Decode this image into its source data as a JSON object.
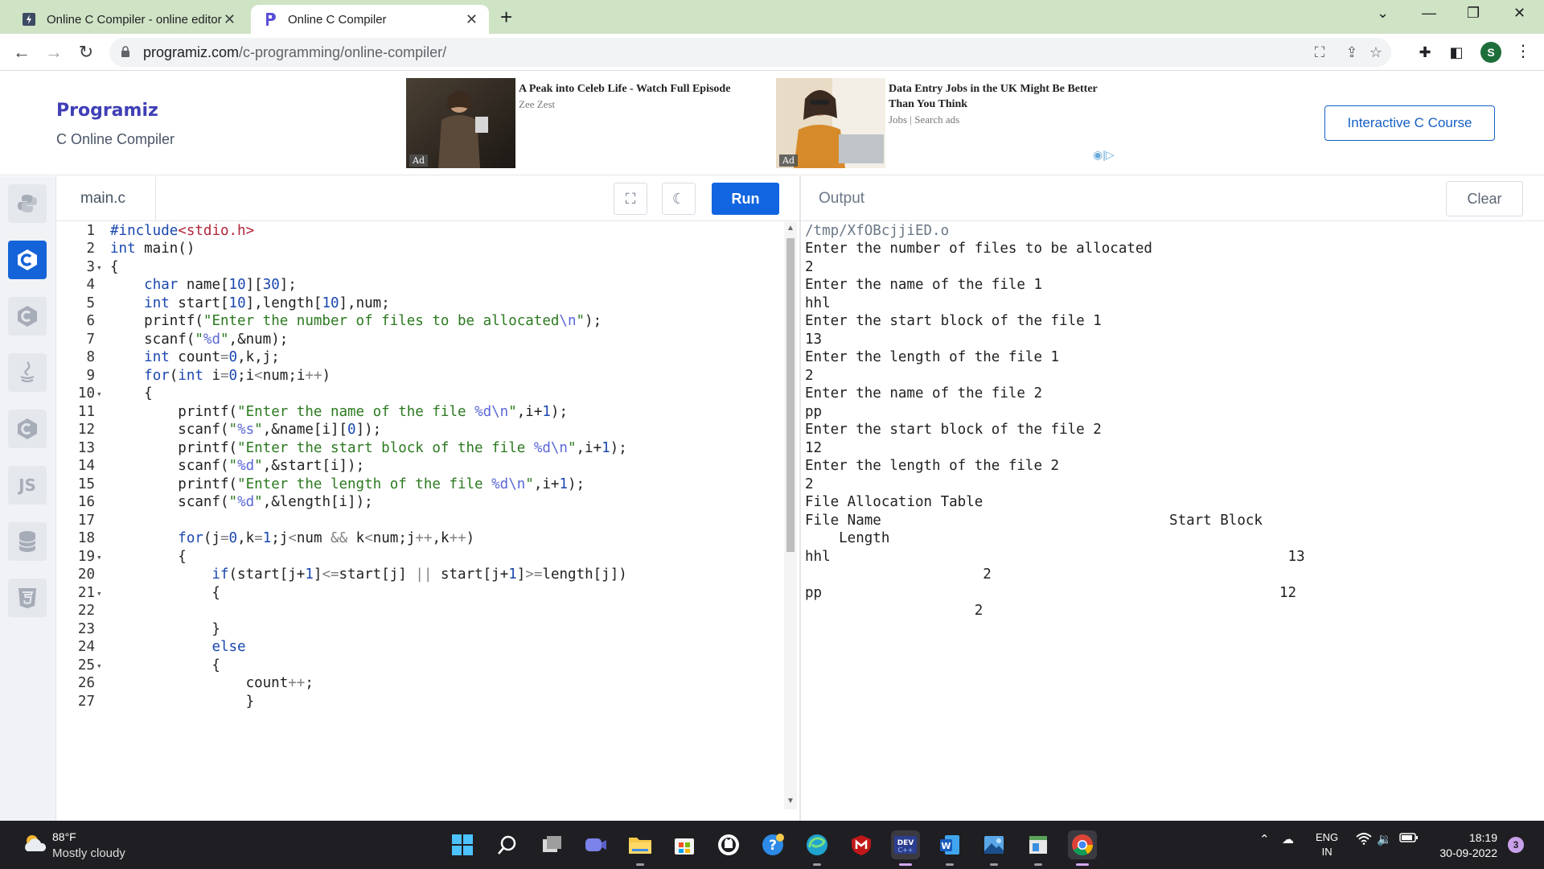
{
  "browser": {
    "tabs": [
      {
        "title": "Online C Compiler - online editor",
        "active": false
      },
      {
        "title": "Online C Compiler",
        "active": true
      }
    ],
    "new_tab": "+",
    "url_host": "programiz.com",
    "url_path": "/c-programming/online-compiler/",
    "profile_initial": "S"
  },
  "site": {
    "logo": "Programiz",
    "subtitle": "C Online Compiler",
    "course_button": "Interactive C Course",
    "ads": [
      {
        "title": "A Peak into Celeb Life - Watch Full Episode",
        "source": "Zee Zest",
        "badge": "Ad"
      },
      {
        "title": "Data Entry Jobs in the UK Might Be Better Than You Think",
        "source": "Jobs | Search ads",
        "badge": "Ad"
      }
    ]
  },
  "sidebar": {
    "languages": [
      {
        "name": "python-icon",
        "active": false
      },
      {
        "name": "c-icon",
        "active": true
      },
      {
        "name": "cpp-icon",
        "active": false
      },
      {
        "name": "java-icon",
        "active": false
      },
      {
        "name": "csharp-icon",
        "active": false
      },
      {
        "name": "js-icon",
        "active": false,
        "label": "JS"
      },
      {
        "name": "sql-icon",
        "active": false
      },
      {
        "name": "html-icon",
        "active": false
      }
    ]
  },
  "editor": {
    "filename": "main.c",
    "run_label": "Run",
    "lines": [
      {
        "n": "1",
        "fold": false,
        "code": "#include<stdio.h>"
      },
      {
        "n": "2",
        "fold": false,
        "code": "int main()"
      },
      {
        "n": "3",
        "fold": true,
        "code": "{"
      },
      {
        "n": "4",
        "fold": false,
        "code": "    char name[10][30];"
      },
      {
        "n": "5",
        "fold": false,
        "code": "    int start[10],length[10],num;"
      },
      {
        "n": "6",
        "fold": false,
        "code": "    printf(\"Enter the number of files to be allocated\\n\");"
      },
      {
        "n": "7",
        "fold": false,
        "code": "    scanf(\"%d\",&num);"
      },
      {
        "n": "8",
        "fold": false,
        "code": "    int count=0,k,j;"
      },
      {
        "n": "9",
        "fold": false,
        "code": "    for(int i=0;i<num;i++)"
      },
      {
        "n": "10",
        "fold": true,
        "code": "    {"
      },
      {
        "n": "11",
        "fold": false,
        "code": "        printf(\"Enter the name of the file %d\\n\",i+1);"
      },
      {
        "n": "12",
        "fold": false,
        "code": "        scanf(\"%s\",&name[i][0]);"
      },
      {
        "n": "13",
        "fold": false,
        "code": "        printf(\"Enter the start block of the file %d\\n\",i+1);"
      },
      {
        "n": "14",
        "fold": false,
        "code": "        scanf(\"%d\",&start[i]);"
      },
      {
        "n": "15",
        "fold": false,
        "code": "        printf(\"Enter the length of the file %d\\n\",i+1);"
      },
      {
        "n": "16",
        "fold": false,
        "code": "        scanf(\"%d\",&length[i]);"
      },
      {
        "n": "17",
        "fold": false,
        "code": ""
      },
      {
        "n": "18",
        "fold": false,
        "code": "        for(j=0,k=1;j<num && k<num;j++,k++)"
      },
      {
        "n": "19",
        "fold": true,
        "code": "        {"
      },
      {
        "n": "20",
        "fold": false,
        "code": "            if(start[j+1]<=start[j] || start[j+1]>=length[j])"
      },
      {
        "n": "21",
        "fold": true,
        "code": "            {"
      },
      {
        "n": "22",
        "fold": false,
        "code": ""
      },
      {
        "n": "23",
        "fold": false,
        "code": "            }"
      },
      {
        "n": "24",
        "fold": false,
        "code": "            else"
      },
      {
        "n": "25",
        "fold": true,
        "code": "            {"
      },
      {
        "n": "26",
        "fold": false,
        "code": "                count++;"
      },
      {
        "n": "27",
        "fold": false,
        "code": "                }"
      }
    ]
  },
  "output": {
    "title": "Output",
    "clear_label": "Clear",
    "lines": [
      "/tmp/XfOBcjjiED.o",
      "Enter the number of files to be allocated",
      "2",
      "Enter the name of the file 1",
      "hhl",
      "Enter the start block of the file 1",
      "13",
      "Enter the length of the file 1",
      "2",
      "Enter the name of the file 2",
      "pp",
      "Enter the start block of the file 2",
      "12",
      "Enter the length of the file 2",
      "2",
      "File Allocation Table",
      "File Name                                  Start Block",
      "    Length",
      "hhl                                                      13",
      "                     2",
      "pp                                                      12",
      "                    2"
    ]
  },
  "taskbar": {
    "temperature": "88°F",
    "condition": "Mostly cloudy",
    "lang_top": "ENG",
    "lang_bottom": "IN",
    "time": "18:19",
    "date": "30-09-2022",
    "notifications": "3",
    "apps": [
      "start-icon",
      "search-icon",
      "task-view-icon",
      "teams-icon",
      "file-explorer-icon",
      "store-icon",
      "github-icon",
      "help-icon",
      "edge-icon",
      "mcafee-icon",
      "devcpp-icon",
      "word-icon",
      "photos-icon",
      "notepad-icon",
      "chrome-icon"
    ]
  }
}
